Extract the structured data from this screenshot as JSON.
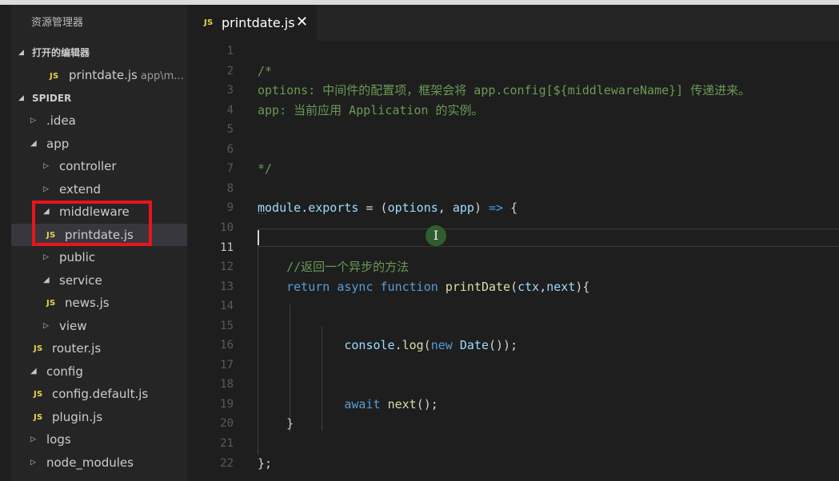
{
  "sidebar": {
    "title": "资源管理器",
    "open_editors_header": "打开的编辑器",
    "open_editors": [
      {
        "name": "printdate.js",
        "path": "app\\m..."
      }
    ],
    "project_header": "SPIDER",
    "tree": [
      {
        "label": ".idea",
        "kind": "folder",
        "state": "closed",
        "depth": 0
      },
      {
        "label": "app",
        "kind": "folder",
        "state": "open",
        "depth": 0
      },
      {
        "label": "controller",
        "kind": "folder",
        "state": "closed",
        "depth": 1
      },
      {
        "label": "extend",
        "kind": "folder",
        "state": "closed",
        "depth": 1
      },
      {
        "label": "middleware",
        "kind": "folder",
        "state": "open",
        "depth": 1
      },
      {
        "label": "printdate.js",
        "kind": "file",
        "depth": 2,
        "selected": true
      },
      {
        "label": "public",
        "kind": "folder",
        "state": "closed",
        "depth": 1
      },
      {
        "label": "service",
        "kind": "folder",
        "state": "open",
        "depth": 1
      },
      {
        "label": "news.js",
        "kind": "file",
        "depth": 2
      },
      {
        "label": "view",
        "kind": "folder",
        "state": "closed",
        "depth": 1
      },
      {
        "label": "router.js",
        "kind": "file",
        "depth": 1
      },
      {
        "label": "config",
        "kind": "folder",
        "state": "open",
        "depth": 0
      },
      {
        "label": "config.default.js",
        "kind": "file",
        "depth": 1
      },
      {
        "label": "plugin.js",
        "kind": "file",
        "depth": 1
      },
      {
        "label": "logs",
        "kind": "folder",
        "state": "closed",
        "depth": 0
      },
      {
        "label": "node_modules",
        "kind": "folder",
        "state": "closed",
        "depth": 0
      }
    ]
  },
  "editor": {
    "tab": {
      "badge": "JS",
      "label": "printdate.js",
      "close_glyph": "✕"
    },
    "active_line": 11,
    "lines": [
      {
        "n": "1",
        "t": []
      },
      {
        "n": "2",
        "t": [
          [
            "comment",
            "/*"
          ]
        ]
      },
      {
        "n": "3",
        "t": [
          [
            "comment",
            "options: 中间件的配置项，框架会将 app.config[${middlewareName}] 传递进来。"
          ]
        ]
      },
      {
        "n": "4",
        "t": [
          [
            "comment",
            "app: 当前应用 Application 的实例。"
          ]
        ]
      },
      {
        "n": "5",
        "t": []
      },
      {
        "n": "6",
        "t": []
      },
      {
        "n": "7",
        "t": [
          [
            "comment",
            "*/"
          ]
        ]
      },
      {
        "n": "8",
        "t": []
      },
      {
        "n": "9",
        "t": [
          [
            "var",
            "module"
          ],
          [
            "plain",
            "."
          ],
          [
            "var",
            "exports"
          ],
          [
            "plain",
            " = ("
          ],
          [
            "var",
            "options"
          ],
          [
            "plain",
            ", "
          ],
          [
            "var",
            "app"
          ],
          [
            "plain",
            ") "
          ],
          [
            "keyword",
            "=>"
          ],
          [
            "plain",
            " {"
          ]
        ]
      },
      {
        "n": "10",
        "t": []
      },
      {
        "n": "11",
        "t": []
      },
      {
        "n": "12",
        "t": [
          [
            "plain",
            "    "
          ],
          [
            "comment",
            "//返回一个异步的方法"
          ]
        ]
      },
      {
        "n": "13",
        "t": [
          [
            "plain",
            "    "
          ],
          [
            "control",
            "return"
          ],
          [
            "plain",
            " "
          ],
          [
            "keyword",
            "async"
          ],
          [
            "plain",
            " "
          ],
          [
            "keyword",
            "function"
          ],
          [
            "plain",
            " "
          ],
          [
            "func",
            "printDate"
          ],
          [
            "plain",
            "("
          ],
          [
            "var",
            "ctx"
          ],
          [
            "plain",
            ","
          ],
          [
            "var",
            "next"
          ],
          [
            "plain",
            "){"
          ]
        ]
      },
      {
        "n": "14",
        "t": []
      },
      {
        "n": "15",
        "t": []
      },
      {
        "n": "16",
        "t": [
          [
            "plain",
            "            "
          ],
          [
            "var",
            "console"
          ],
          [
            "plain",
            "."
          ],
          [
            "func",
            "log"
          ],
          [
            "plain",
            "("
          ],
          [
            "keyword",
            "new"
          ],
          [
            "plain",
            " "
          ],
          [
            "var",
            "Date"
          ],
          [
            "plain",
            "());"
          ]
        ]
      },
      {
        "n": "17",
        "t": []
      },
      {
        "n": "18",
        "t": []
      },
      {
        "n": "19",
        "t": [
          [
            "plain",
            "            "
          ],
          [
            "control",
            "await"
          ],
          [
            "plain",
            " "
          ],
          [
            "func",
            "next"
          ],
          [
            "plain",
            "();"
          ]
        ]
      },
      {
        "n": "20",
        "t": [
          [
            "plain",
            "    }"
          ]
        ]
      },
      {
        "n": "21",
        "t": []
      },
      {
        "n": "22",
        "t": [
          [
            "plain",
            "};"
          ]
        ]
      }
    ]
  },
  "colors": {
    "highlight_box": "#e8141c",
    "js_badge": "#e8d44d",
    "comment": "#6a9955",
    "keyword": "#569cd6",
    "function": "#dcdcaa",
    "variable": "#9cdcfe"
  },
  "icons": {
    "mouse_cursor": "text-cursor-icon"
  }
}
